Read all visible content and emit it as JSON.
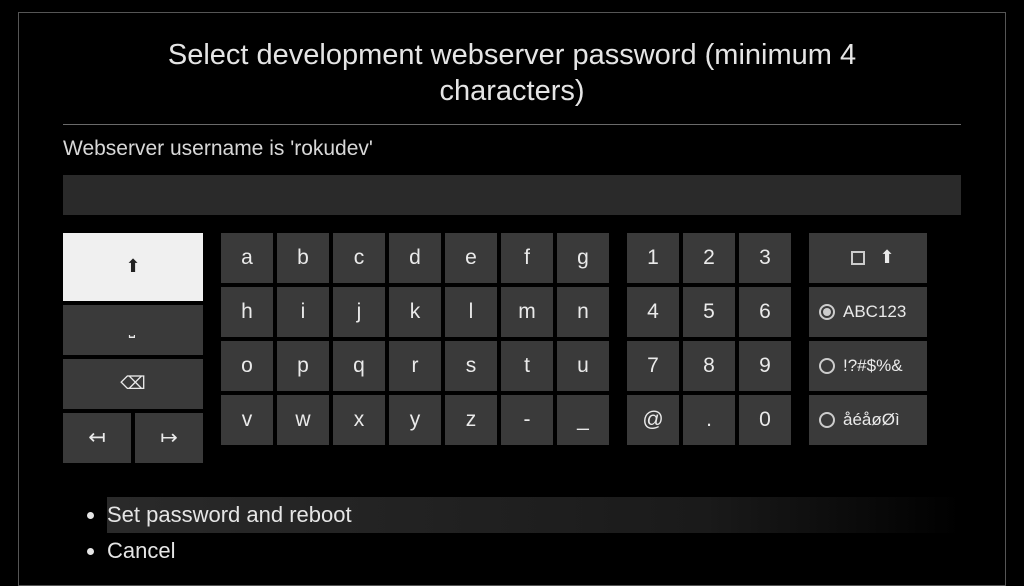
{
  "title": "Select development webserver password (minimum 4 characters)",
  "subtitle": "Webserver username is 'rokudev'",
  "input_value": "",
  "keyboard": {
    "controls": {
      "shift_icon": "⬆",
      "space_icon": "⎵",
      "backspace_icon": "⌫",
      "cursor_left_icon": "↤",
      "cursor_right_icon": "↦"
    },
    "alpha_rows": [
      [
        "a",
        "b",
        "c",
        "d",
        "e",
        "f",
        "g"
      ],
      [
        "h",
        "i",
        "j",
        "k",
        "l",
        "m",
        "n"
      ],
      [
        "o",
        "p",
        "q",
        "r",
        "s",
        "t",
        "u"
      ],
      [
        "v",
        "w",
        "x",
        "y",
        "z",
        "-",
        "_"
      ]
    ],
    "num_rows": [
      [
        "1",
        "2",
        "3"
      ],
      [
        "4",
        "5",
        "6"
      ],
      [
        "7",
        "8",
        "9"
      ],
      [
        "@",
        ".",
        "0"
      ]
    ],
    "modes": {
      "caps_icon": "⬆",
      "abc_label": "ABC123",
      "symbols_label": "!?#$%&",
      "accents_label": "åéåøØì"
    },
    "selected_mode": "abc"
  },
  "options": {
    "set_password": "Set password and reboot",
    "cancel": "Cancel"
  }
}
